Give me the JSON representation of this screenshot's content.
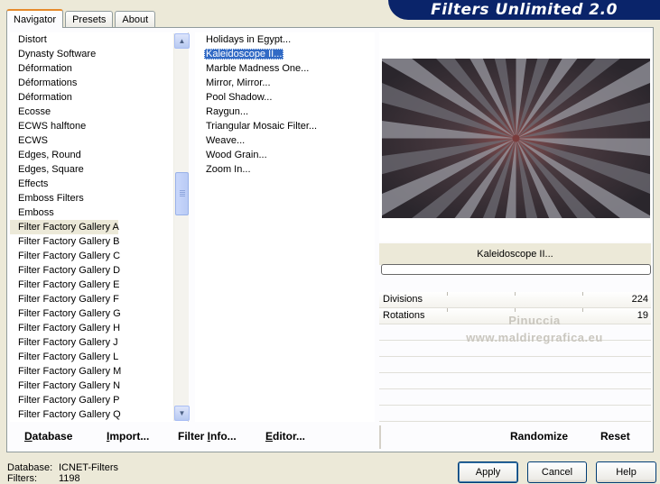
{
  "banner": {
    "title": "Filters Unlimited 2.0"
  },
  "tabs": [
    {
      "label": "Navigator",
      "active": true
    },
    {
      "label": "Presets"
    },
    {
      "label": "About"
    }
  ],
  "categories": [
    "Distort",
    "Dynasty Software",
    "Déformation",
    "Déformations",
    "Déformation",
    "Ecosse",
    "ECWS halftone",
    "ECWS",
    "Edges, Round",
    "Edges, Square",
    "Effects",
    "Emboss Filters",
    "Emboss",
    "Filter Factory Gallery A",
    "Filter Factory Gallery B",
    "Filter Factory Gallery C",
    "Filter Factory Gallery D",
    "Filter Factory Gallery E",
    "Filter Factory Gallery F",
    "Filter Factory Gallery G",
    "Filter Factory Gallery H",
    "Filter Factory Gallery J",
    "Filter Factory Gallery L",
    "Filter Factory Gallery M",
    "Filter Factory Gallery N",
    "Filter Factory Gallery P",
    "Filter Factory Gallery Q"
  ],
  "selected_category": "Filter Factory Gallery A",
  "filters": [
    "Holidays in Egypt...",
    "Kaleidoscope II...",
    "Marble Madness One...",
    "Mirror, Mirror...",
    "Pool Shadow...",
    "Raygun...",
    "Triangular Mosaic Filter...",
    "Weave...",
    "Wood Grain...",
    "Zoom In..."
  ],
  "selected_filter": "Kaleidoscope II...",
  "preview": {
    "filter_name": "Kaleidoscope II..."
  },
  "params": [
    {
      "label": "Divisions",
      "value": "224",
      "level": 0.88
    },
    {
      "label": "Rotations",
      "value": "19",
      "level": 0.07
    }
  ],
  "watermark": {
    "line1": "Pinuccia",
    "line2": "www.maldiregrafica.eu"
  },
  "commands": {
    "database": {
      "u": "D",
      "rest": "atabase"
    },
    "import": {
      "u": "I",
      "rest": "mport..."
    },
    "filter_info": {
      "pre": "Filter ",
      "u": "I",
      "rest": "nfo..."
    },
    "editor": {
      "u": "E",
      "rest": "ditor..."
    },
    "randomize": "Randomize",
    "reset": "Reset"
  },
  "status": {
    "database_label": "Database:",
    "database_value": "ICNET-Filters",
    "filters_label": "Filters:",
    "filters_value": "1198"
  },
  "buttons": {
    "apply": "Apply",
    "cancel": "Cancel",
    "help": "Help"
  }
}
